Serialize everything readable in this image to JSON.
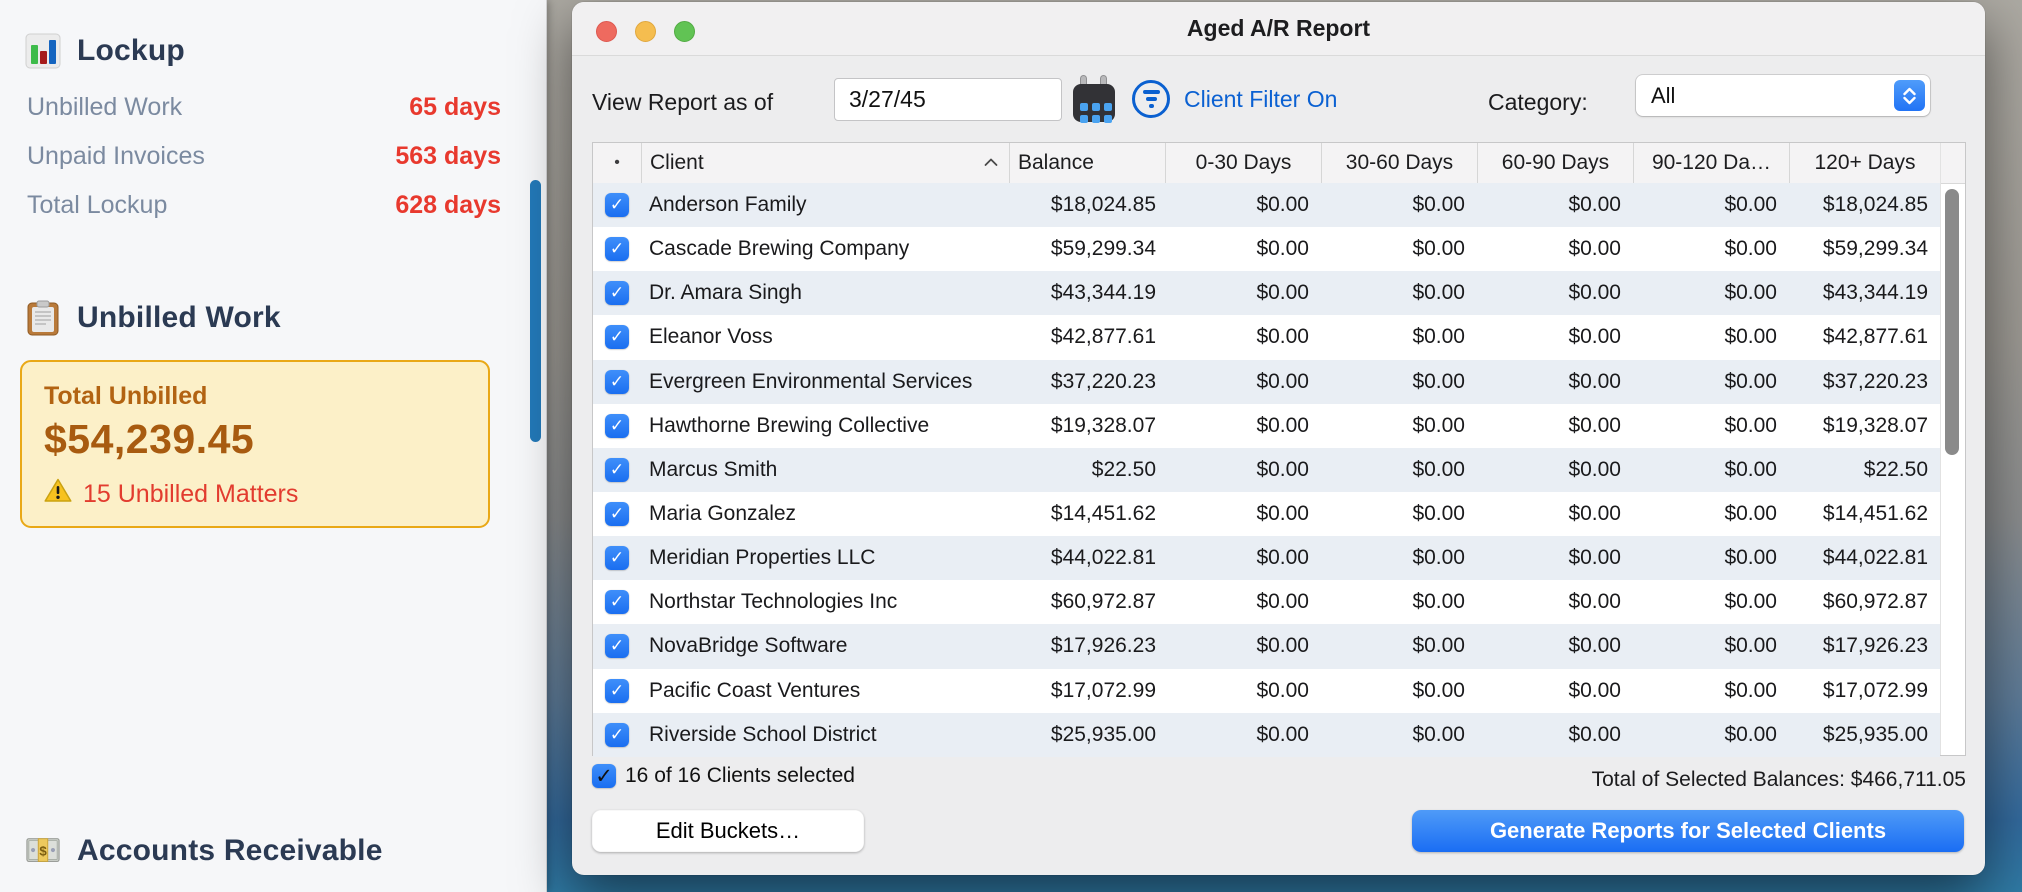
{
  "sidebar": {
    "lockup": {
      "title": "Lockup",
      "rows": [
        {
          "label": "Unbilled Work",
          "value": "65 days"
        },
        {
          "label": "Unpaid Invoices",
          "value": "563 days"
        },
        {
          "label": "Total Lockup",
          "value": "628 days"
        }
      ]
    },
    "unbilled": {
      "title": "Unbilled Work",
      "card": {
        "label": "Total Unbilled",
        "amount": "$54,239.45",
        "warning": "15 Unbilled Matters"
      }
    },
    "accounts_receivable": {
      "title": "Accounts Receivable"
    }
  },
  "window": {
    "title": "Aged A/R Report",
    "toolbar": {
      "view_report_label": "View Report as of",
      "date_value": "3/27/45",
      "filter_label": "Client Filter On",
      "category_label": "Category:",
      "category_value": "All"
    },
    "table": {
      "columns": [
        "•",
        "Client",
        "Balance",
        "0-30 Days",
        "30-60 Days",
        "60-90 Days",
        "90-120 Da…",
        "120+ Days"
      ],
      "rows": [
        {
          "client": "Anderson Family",
          "cells": [
            "$18,024.85",
            "$0.00",
            "$0.00",
            "$0.00",
            "$0.00",
            "$18,024.85"
          ]
        },
        {
          "client": "Cascade Brewing Company",
          "cells": [
            "$59,299.34",
            "$0.00",
            "$0.00",
            "$0.00",
            "$0.00",
            "$59,299.34"
          ]
        },
        {
          "client": "Dr. Amara Singh",
          "cells": [
            "$43,344.19",
            "$0.00",
            "$0.00",
            "$0.00",
            "$0.00",
            "$43,344.19"
          ]
        },
        {
          "client": "Eleanor Voss",
          "cells": [
            "$42,877.61",
            "$0.00",
            "$0.00",
            "$0.00",
            "$0.00",
            "$42,877.61"
          ]
        },
        {
          "client": "Evergreen Environmental Services",
          "cells": [
            "$37,220.23",
            "$0.00",
            "$0.00",
            "$0.00",
            "$0.00",
            "$37,220.23"
          ]
        },
        {
          "client": "Hawthorne Brewing Collective",
          "cells": [
            "$19,328.07",
            "$0.00",
            "$0.00",
            "$0.00",
            "$0.00",
            "$19,328.07"
          ]
        },
        {
          "client": "Marcus Smith",
          "cells": [
            "$22.50",
            "$0.00",
            "$0.00",
            "$0.00",
            "$0.00",
            "$22.50"
          ]
        },
        {
          "client": "Maria Gonzalez",
          "cells": [
            "$14,451.62",
            "$0.00",
            "$0.00",
            "$0.00",
            "$0.00",
            "$14,451.62"
          ]
        },
        {
          "client": "Meridian Properties LLC",
          "cells": [
            "$44,022.81",
            "$0.00",
            "$0.00",
            "$0.00",
            "$0.00",
            "$44,022.81"
          ]
        },
        {
          "client": "Northstar Technologies Inc",
          "cells": [
            "$60,972.87",
            "$0.00",
            "$0.00",
            "$0.00",
            "$0.00",
            "$60,972.87"
          ]
        },
        {
          "client": "NovaBridge Software",
          "cells": [
            "$17,926.23",
            "$0.00",
            "$0.00",
            "$0.00",
            "$0.00",
            "$17,926.23"
          ]
        },
        {
          "client": "Pacific Coast Ventures",
          "cells": [
            "$17,072.99",
            "$0.00",
            "$0.00",
            "$0.00",
            "$0.00",
            "$17,072.99"
          ]
        },
        {
          "client": "Riverside School District",
          "cells": [
            "$25,935.00",
            "$0.00",
            "$0.00",
            "$0.00",
            "$0.00",
            "$25,935.00"
          ]
        }
      ]
    },
    "footer": {
      "selected_summary": "16 of 16 Clients selected",
      "total_label": "Total of Selected Balances: $466,711.05",
      "edit_buckets_label": "Edit Buckets…",
      "generate_label": "Generate Reports for Selected Clients"
    }
  },
  "colors": {
    "accent_blue": "#2173f5",
    "link_blue": "#0b61d2",
    "alert_red": "#e8392e",
    "unbilled_amber": "#a85b10",
    "card_background": "#fcf0c8",
    "card_border": "#e9a816",
    "row_stripe": "#e9eef4",
    "sidebar_scrollbar_blue": "#2379b8"
  }
}
